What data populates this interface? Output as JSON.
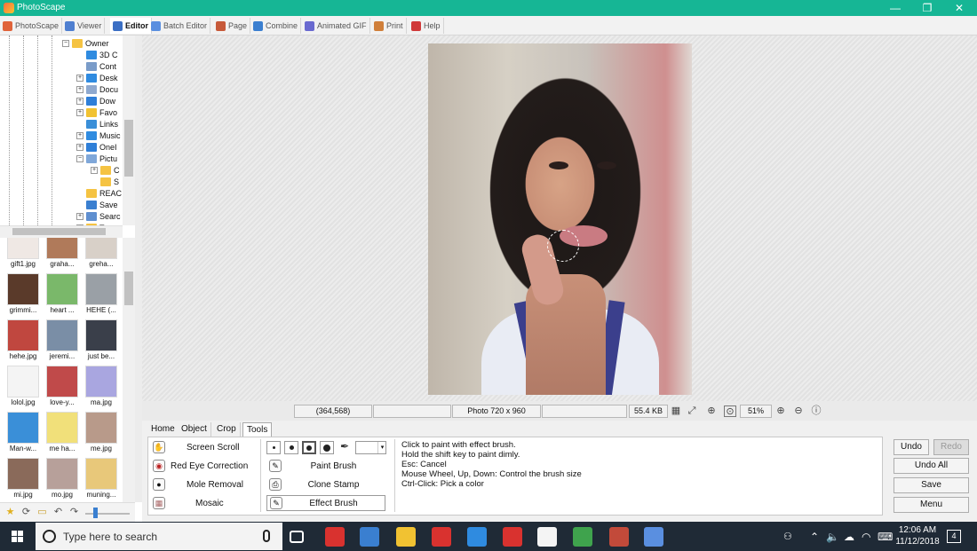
{
  "window": {
    "title": "PhotoScape",
    "controls": [
      "—",
      "❐",
      "✕"
    ]
  },
  "tabs": [
    {
      "label": "PhotoScape",
      "color": "#e0633a"
    },
    {
      "label": "Viewer",
      "color": "#4f7fd0"
    },
    {
      "label": "Editor",
      "color": "#3b6fc4",
      "active": true
    },
    {
      "label": "Batch Editor",
      "color": "#5a8fe0"
    },
    {
      "label": "Page",
      "color": "#c75a3a"
    },
    {
      "label": "Combine",
      "color": "#3b7fd0"
    },
    {
      "label": "Animated GIF",
      "color": "#6a6ad0"
    },
    {
      "label": "Print",
      "color": "#d07f3a"
    },
    {
      "label": "Help",
      "color": "#d03a3a"
    }
  ],
  "tree": {
    "nodes": [
      {
        "label": "Owner",
        "expander": "−",
        "color": "#f5c342"
      },
      {
        "label": "3D C",
        "expander": "",
        "color": "#2f8be0"
      },
      {
        "label": "Cont",
        "expander": "",
        "color": "#7a9cc9"
      },
      {
        "label": "Desk",
        "expander": "+",
        "color": "#2f8be0"
      },
      {
        "label": "Docu",
        "expander": "+",
        "color": "#8fa9cf"
      },
      {
        "label": "Dow",
        "expander": "+",
        "color": "#2f7fd8"
      },
      {
        "label": "Favo",
        "expander": "+",
        "color": "#f1c232"
      },
      {
        "label": "Links",
        "expander": "",
        "color": "#3a8fd8"
      },
      {
        "label": "Music",
        "expander": "+",
        "color": "#2f8be0"
      },
      {
        "label": "OneI",
        "expander": "+",
        "color": "#2f7fd8"
      },
      {
        "label": "Pictu",
        "expander": "−",
        "color": "#7fa7d9"
      },
      {
        "label": "C",
        "expander": "+",
        "color": "#f5c342"
      },
      {
        "label": "S",
        "expander": "",
        "color": "#f5c342"
      },
      {
        "label": "REAC",
        "expander": "",
        "color": "#f5c342"
      },
      {
        "label": "Save",
        "expander": "",
        "color": "#3a7fd0"
      },
      {
        "label": "Searc",
        "expander": "+",
        "color": "#5f8fd0"
      },
      {
        "label": "T",
        "expander": "+",
        "color": "#f5c342"
      }
    ]
  },
  "thumbnails": [
    {
      "name": "gift1.jpg",
      "color": "#efe8e4"
    },
    {
      "name": "graha...",
      "color": "#b07a5a"
    },
    {
      "name": "greha...",
      "color": "#d8d0c8"
    },
    {
      "name": "grimmi...",
      "color": "#5a3a2a"
    },
    {
      "name": "heart ...",
      "color": "#7ab86a"
    },
    {
      "name": "HEHE (...",
      "color": "#9aa0a6"
    },
    {
      "name": "hehe.jpg",
      "color": "#c0473f"
    },
    {
      "name": "jeremi...",
      "color": "#7a8ea6"
    },
    {
      "name": "just be...",
      "color": "#3a3f4a"
    },
    {
      "name": "lolol.jpg",
      "color": "#f4f4f4"
    },
    {
      "name": "love-y...",
      "color": "#c04a4a"
    },
    {
      "name": "ma.jpg",
      "color": "#a9a6e0"
    },
    {
      "name": "Man-w...",
      "color": "#3a8fd8"
    },
    {
      "name": "me ha...",
      "color": "#f1e07a"
    },
    {
      "name": "me.jpg",
      "color": "#b89a8a"
    },
    {
      "name": "mi.jpg",
      "color": "#8a6a5a"
    },
    {
      "name": "mo.jpg",
      "color": "#b7a09a"
    },
    {
      "name": "muning...",
      "color": "#e8c87a"
    }
  ],
  "left_toolbar_icons": [
    "star-icon",
    "refresh-icon",
    "folder-icon",
    "back-icon",
    "forward-icon"
  ],
  "status": {
    "coords": "(364,568)",
    "photo_size": "Photo 720 x 960",
    "file_size": "55.4 KB",
    "zoom": "51%"
  },
  "tool_tabs": [
    "Home",
    "Object",
    "Crop",
    "Tools"
  ],
  "tools": {
    "left": [
      {
        "label": "Screen Scroll",
        "icon": "hand-icon",
        "glyph": "✋"
      },
      {
        "label": "Red Eye Correction",
        "icon": "red-eye-icon",
        "glyph": "◉"
      },
      {
        "label": "Mole Removal",
        "icon": "mole-removal-icon",
        "glyph": "●"
      },
      {
        "label": "Mosaic",
        "icon": "mosaic-icon",
        "glyph": "▦"
      }
    ],
    "middle": [
      {
        "label": "Paint Brush",
        "icon": "paint-brush-icon",
        "glyph": "✎"
      },
      {
        "label": "Clone Stamp",
        "icon": "clone-stamp-icon",
        "glyph": "⎙"
      },
      {
        "label": "Effect Brush",
        "icon": "effect-brush-icon",
        "glyph": "✎"
      }
    ],
    "help": [
      "Click to paint with effect brush.",
      "Hold the shift key to paint dimly.",
      "Esc: Cancel",
      "Mouse Wheel, Up, Down: Control the brush size",
      "Ctrl-Click: Pick a color"
    ]
  },
  "actions": {
    "undo": "Undo",
    "redo": "Redo",
    "undo_all": "Undo All",
    "save": "Save",
    "menu": "Menu"
  },
  "taskbar": {
    "search_placeholder": "Type here to search",
    "time": "12:06 AM",
    "date": "11/12/2018",
    "notifications": "4",
    "apps": [
      {
        "name": "task-view-icon",
        "color": "#1f2a36"
      },
      {
        "name": "red-app-icon",
        "color": "#d9322f"
      },
      {
        "name": "store-icon",
        "color": "#3a7fd0"
      },
      {
        "name": "file-explorer-icon",
        "color": "#f1c232"
      },
      {
        "name": "red-box-icon",
        "color": "#d9322f"
      },
      {
        "name": "edge-icon",
        "color": "#2f8be0"
      },
      {
        "name": "pdf-icon",
        "color": "#d9322f"
      },
      {
        "name": "mail-icon",
        "color": "#f4f4f4"
      },
      {
        "name": "chrome-icon",
        "color": "#3fa34d"
      },
      {
        "name": "photoscape-icon",
        "color": "#c24a3a"
      },
      {
        "name": "paint-icon",
        "color": "#5a8fe0"
      }
    ]
  }
}
